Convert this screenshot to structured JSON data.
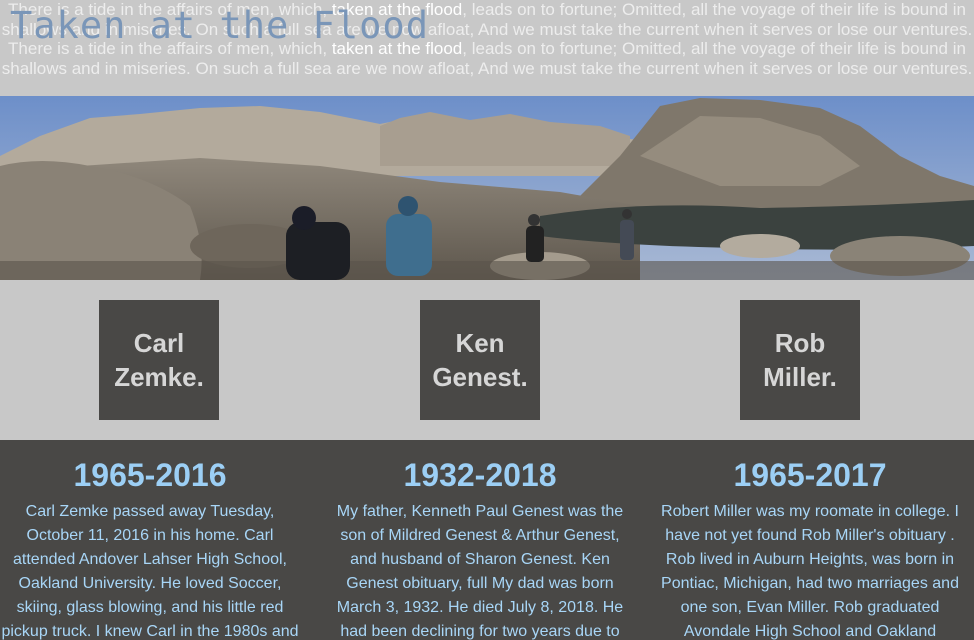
{
  "header": {
    "title": "Taken at the Flood",
    "quote_line1_a": "There is a tide in the affairs of men, which, ",
    "quote_line1_hl": "taken at the flood",
    "quote_line1_b": ", leads on to fortune; Omitted, all the voyage of their life is bound in shallows and in miseries. On such a full sea are we now afloat, And we must take the current when it serves or lose our ventures.",
    "quote_line2_a": "There is a tide in the affairs of men, which, ",
    "quote_line2_hl": "taken at the flood",
    "quote_line2_b": ", leads on to fortune; Omitted, all the voyage of their life is bound in shallows and in miseries. On such a full sea are we now afloat, And we must take the current when it serves or lose our ventures."
  },
  "people": [
    {
      "name_line1": "Carl",
      "name_line2": "Zemke.",
      "years": "1965-2016",
      "bio": "Carl Zemke passed away Tuesday, October 11, 2016 in his home. Carl attended Andover Lahser High School, Oakland University. He loved Soccer, skiing, glass blowing, and his little red pickup truck. I knew Carl in the 1980s and"
    },
    {
      "name_line1": "Ken",
      "name_line2": "Genest.",
      "years": "1932-2018",
      "bio": "My father, Kenneth Paul Genest was the son of Mildred Genest & Arthur Genest, and husband of Sharon Genest. Ken Genest obituary, full My dad was born March 3, 1932. He died July 8, 2018. He had been declining for two years due to"
    },
    {
      "name_line1": "Rob",
      "name_line2": "Miller.",
      "years": "1965-2017",
      "bio": "Robert Miller was my roomate in college. I have not yet found Rob Miller's obituary . Rob lived in Auburn Heights, was born in Pontiac, Michigan, had two marriages and one son, Evan Miller. Rob graduated Avondale High School and Oakland"
    }
  ],
  "colors": {
    "title": "#7a96b8",
    "card_bg": "#494846",
    "years": "#9ccff5",
    "bio_text": "#a8d6f7",
    "page_bg": "#c8c8c8"
  }
}
